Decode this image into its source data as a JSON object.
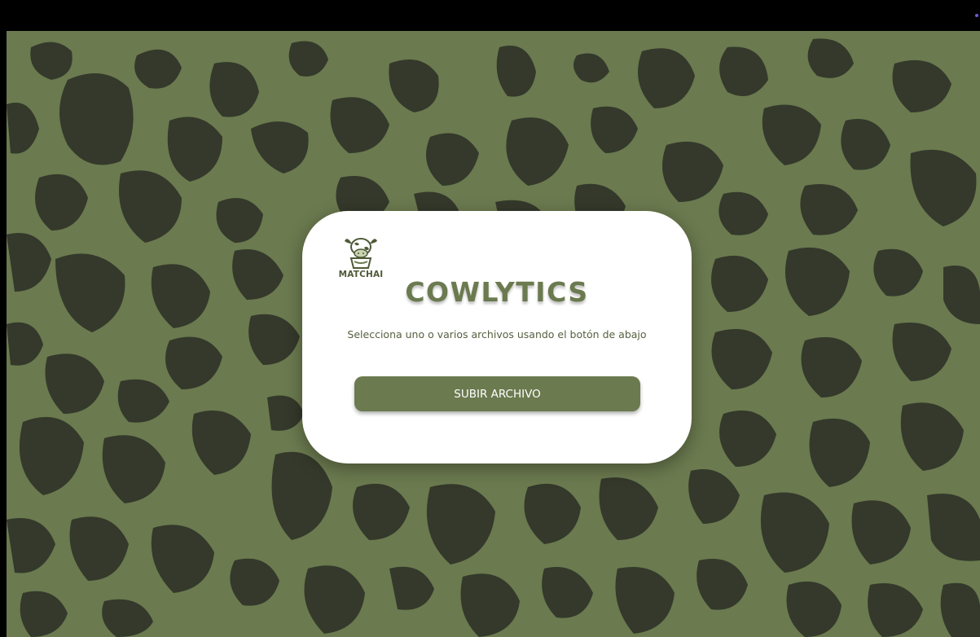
{
  "theme": {
    "background": "#6b7a4f",
    "spots": "#34392b",
    "card": "#ffffff",
    "accent": "#6b7a4f",
    "button_text": "#ffffff"
  },
  "brand": {
    "logo_icon": "cow-icon",
    "logo_text": "MATCHAI"
  },
  "card": {
    "title": "COWLYTICS",
    "instructions": "Selecciona uno o varios archivos usando el botón de abajo",
    "upload_button": "SUBIR ARCHIVO"
  }
}
